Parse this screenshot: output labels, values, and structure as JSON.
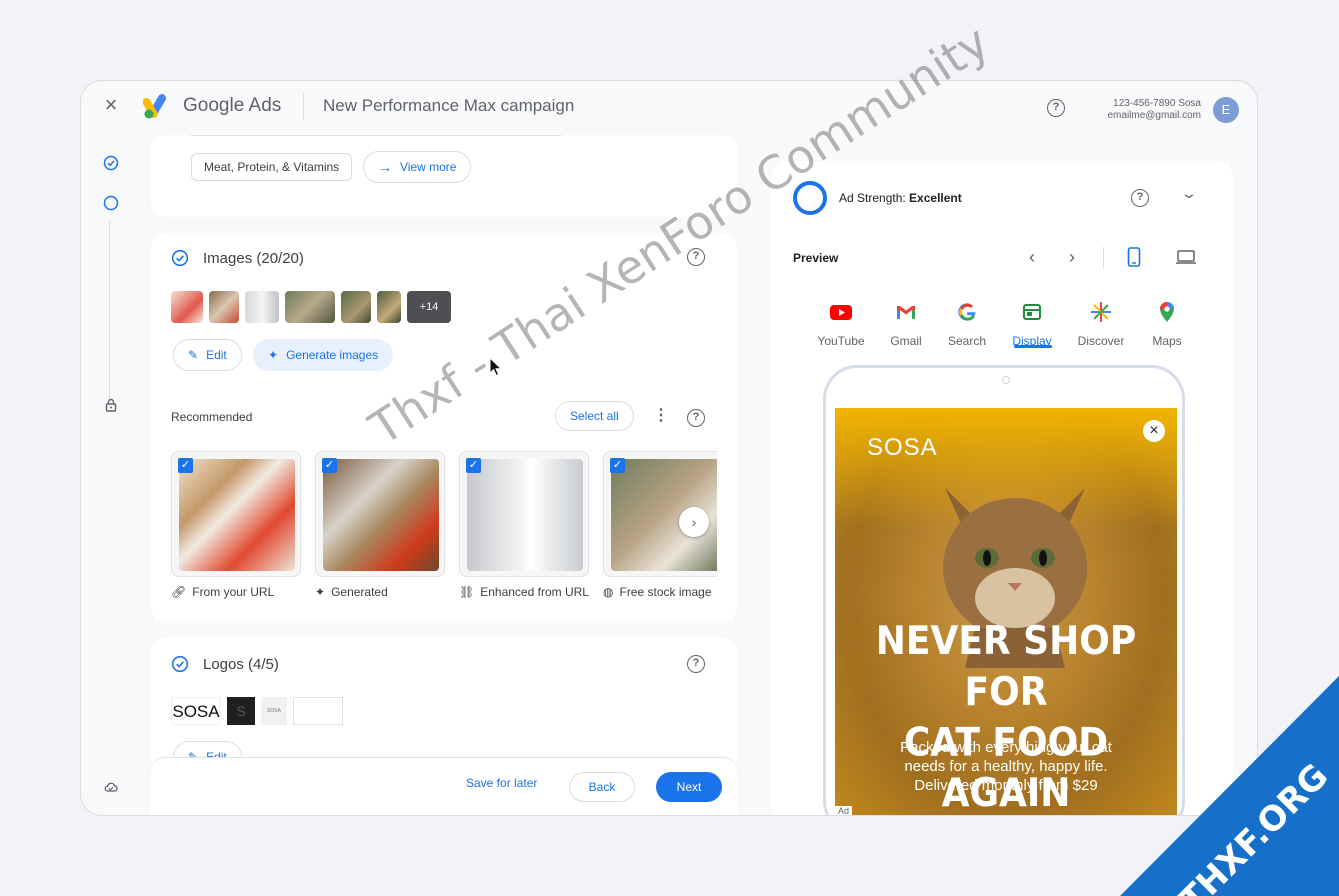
{
  "header": {
    "logo_google": "Google",
    "logo_ads": "Ads",
    "campaign_title": "New Performance Max campaign",
    "account_line1": "123-456-7890 Sosa",
    "account_line2": "emailme@gmail.com",
    "avatar_initial": "E"
  },
  "interests": {
    "chip": "Meat, Protein, & Vitamins",
    "view_more": "View more"
  },
  "images": {
    "title": "Images (20/20)",
    "more_count": "+14",
    "edit_label": "Edit",
    "generate_label": "Generate images",
    "recommended_label": "Recommended",
    "select_all_label": "Select all",
    "recommended": [
      {
        "label": "From your URL",
        "icon": "link-icon"
      },
      {
        "label": "Generated",
        "icon": "sparkle-icon"
      },
      {
        "label": "Enhanced from URL",
        "icon": "enhanced-link-icon"
      },
      {
        "label": "Free stock image",
        "icon": "globe-icon"
      }
    ]
  },
  "logos": {
    "title": "Logos (4/5)",
    "logo_text": "SOSA",
    "small_logo_text": "SOSA",
    "edit_label": "Edit"
  },
  "footer": {
    "save_later": "Save for later",
    "back": "Back",
    "next": "Next"
  },
  "preview": {
    "strength_prefix": "Ad Strength: ",
    "strength_value": "Excellent",
    "preview_label": "Preview",
    "channels": [
      {
        "label": "YouTube",
        "icon": "youtube-icon"
      },
      {
        "label": "Gmail",
        "icon": "gmail-icon"
      },
      {
        "label": "Search",
        "icon": "google-search-icon"
      },
      {
        "label": "Display",
        "icon": "display-icon",
        "active": true
      },
      {
        "label": "Discover",
        "icon": "discover-icon"
      },
      {
        "label": "Maps",
        "icon": "maps-icon"
      }
    ],
    "ad": {
      "brand": "SOSA",
      "headline_line1": "NEVER SHOP FOR",
      "headline_line2": "CAT FOOD AGAIN",
      "sub_line1": "Packed with everything your cat",
      "sub_line2": "needs for a healthy, happy life.",
      "sub_line3": "Delivered monthly from $29",
      "tag": "Ad"
    }
  },
  "watermark": "Thxf - Thai XenForo Community",
  "corner_badge": "THXF.ORG",
  "colors": {
    "accent": "#1a73e8",
    "badge": "#1670c9",
    "ad_yellow": "#f1b400"
  }
}
